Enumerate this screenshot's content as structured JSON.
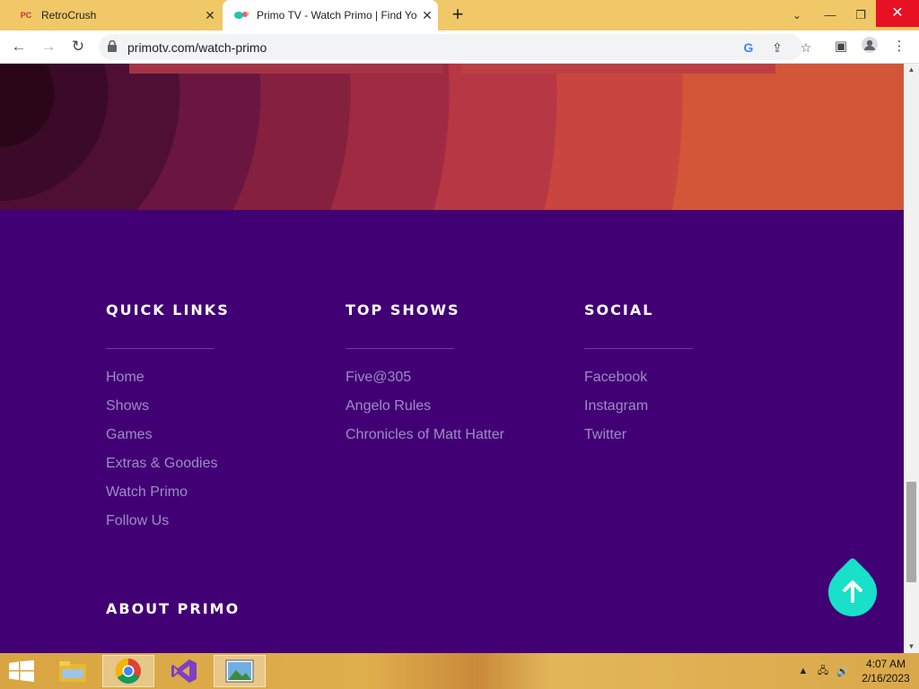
{
  "browser": {
    "tabs": [
      {
        "title": "RetroCrush",
        "favicon": "PC",
        "active": false
      },
      {
        "title": "Primo TV - Watch Primo | Find Yo",
        "favicon": "primo-logo",
        "active": true
      }
    ],
    "url": "primotv.com/watch-primo"
  },
  "footer": {
    "quick_links": {
      "heading": "QUICK LINKS",
      "items": [
        "Home",
        "Shows",
        "Games",
        "Extras & Goodies",
        "Watch Primo",
        "Follow Us"
      ]
    },
    "top_shows": {
      "heading": "TOP SHOWS",
      "items": [
        "Five@305",
        "Angelo Rules",
        "Chronicles of Matt Hatter"
      ]
    },
    "social": {
      "heading": "SOCIAL",
      "items": [
        "Facebook",
        "Instagram",
        "Twitter"
      ]
    },
    "about_heading": "ABOUT PRIMO"
  },
  "taskbar": {
    "time": "4:07 AM",
    "date": "2/16/2023"
  },
  "colors": {
    "footer_bg": "#420075",
    "link": "#9d8cc4",
    "accent": "#19e0c8"
  }
}
